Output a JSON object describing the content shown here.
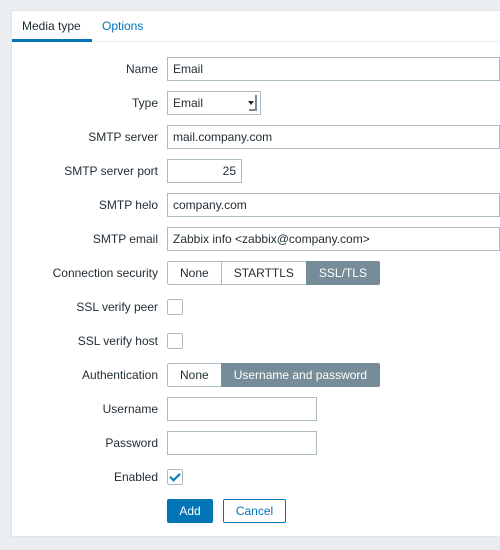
{
  "tabs": [
    {
      "label": "Media type",
      "active": true
    },
    {
      "label": "Options",
      "active": false
    }
  ],
  "form": {
    "name": {
      "label": "Name",
      "value": "Email"
    },
    "type": {
      "label": "Type",
      "value": "Email"
    },
    "smtp_server": {
      "label": "SMTP server",
      "value": "mail.company.com"
    },
    "smtp_port": {
      "label": "SMTP server port",
      "value": "25"
    },
    "smtp_helo": {
      "label": "SMTP helo",
      "value": "company.com"
    },
    "smtp_email": {
      "label": "SMTP email",
      "value": "Zabbix info <zabbix@company.com>"
    },
    "connection_security": {
      "label": "Connection security",
      "options": [
        "None",
        "STARTTLS",
        "SSL/TLS"
      ],
      "selected": "SSL/TLS"
    },
    "ssl_verify_peer": {
      "label": "SSL verify peer",
      "checked": false
    },
    "ssl_verify_host": {
      "label": "SSL verify host",
      "checked": false
    },
    "authentication": {
      "label": "Authentication",
      "options": [
        "None",
        "Username and password"
      ],
      "selected": "Username and password"
    },
    "username": {
      "label": "Username",
      "value": ""
    },
    "password": {
      "label": "Password",
      "value": ""
    },
    "enabled": {
      "label": "Enabled",
      "checked": true
    }
  },
  "buttons": {
    "add": "Add",
    "cancel": "Cancel"
  },
  "colors": {
    "accent": "#0275b8",
    "segment_selected": "#768d99",
    "background": "#ebeef0"
  }
}
